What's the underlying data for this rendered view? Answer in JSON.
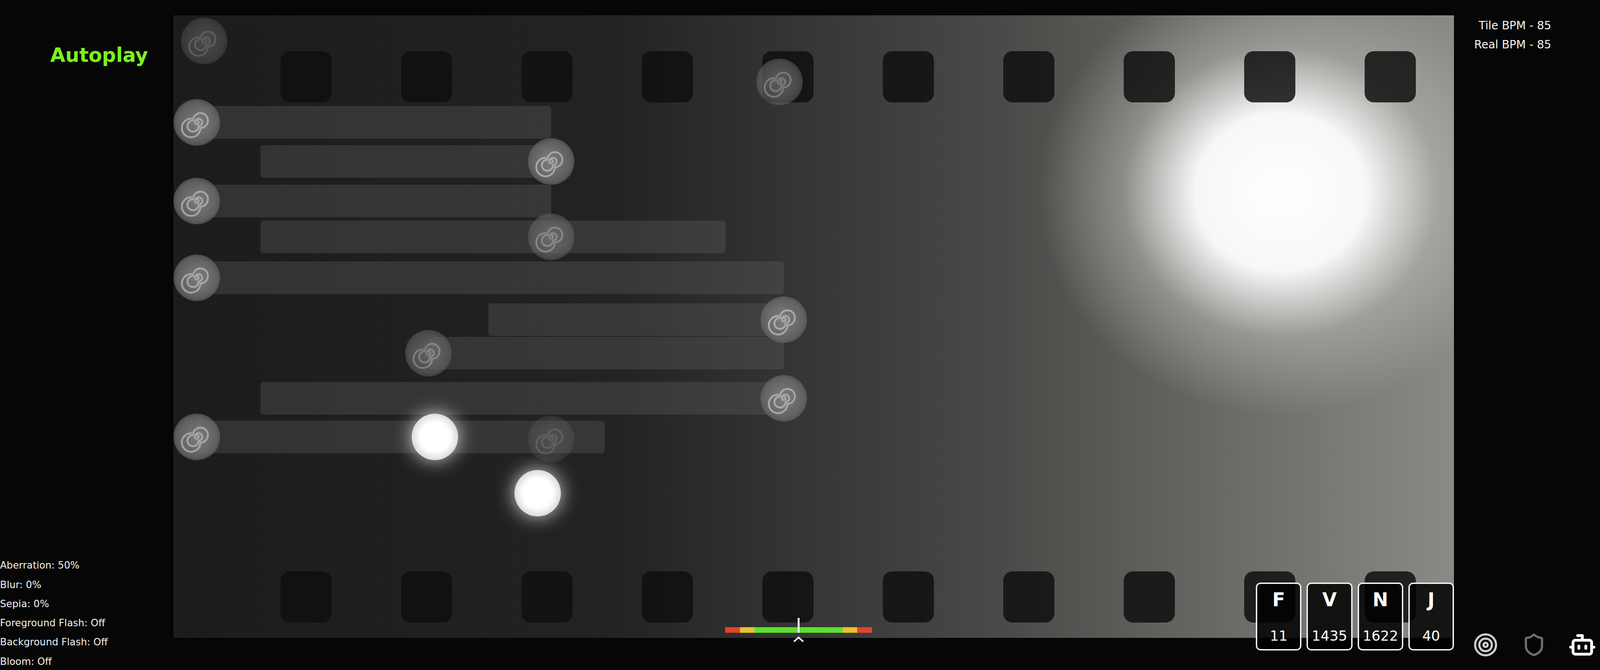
{
  "hud": {
    "mode": "Autoplay",
    "bpm": [
      {
        "label": "Tile BPM - 85"
      },
      {
        "label": "Real BPM - 85"
      }
    ]
  },
  "settings": [
    {
      "label": "Aberration: 50%"
    },
    {
      "label": "Blur: 0%"
    },
    {
      "label": "Sepia: 0%"
    },
    {
      "label": "Foreground Flash: Off"
    },
    {
      "label": "Background Flash: Off"
    },
    {
      "label": "Bloom: Off"
    }
  ],
  "judgements": [
    {
      "letter": "F",
      "count": "11"
    },
    {
      "letter": "V",
      "count": "1435"
    },
    {
      "letter": "N",
      "count": "1622"
    },
    {
      "letter": "J",
      "count": "40"
    }
  ],
  "hit_error_meter": {
    "level": 0.5
  },
  "tiles": [
    {
      "lit": false
    },
    {
      "lit": false
    },
    {
      "lit": false
    },
    {
      "lit": false
    },
    {
      "lit": false
    },
    {
      "lit": false
    },
    {
      "lit": false
    },
    {
      "lit": false
    },
    {
      "lit": false
    },
    {
      "lit": false
    },
    {
      "lit": false
    },
    {
      "lit": true
    },
    {
      "lit": true
    },
    {
      "lit": false
    }
  ]
}
